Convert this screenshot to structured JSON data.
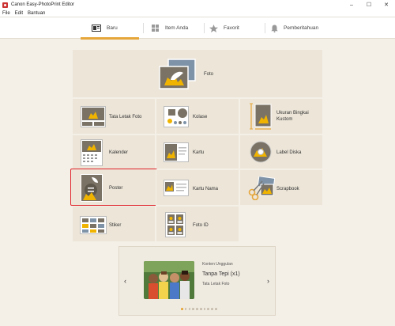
{
  "window": {
    "title": "Canon Easy-PhotoPrint Editor",
    "minimize": "–",
    "maximize": "☐",
    "close": "✕"
  },
  "menu": [
    "File",
    "Edit",
    "Bantuan"
  ],
  "tabs": [
    {
      "label": "Baru",
      "icon": "new-icon",
      "active": true
    },
    {
      "label": "Item Anda",
      "icon": "grid-icon",
      "active": false
    },
    {
      "label": "Favorit",
      "icon": "star-icon",
      "active": false
    },
    {
      "label": "Pemberitahuan",
      "icon": "bell-icon",
      "active": false
    }
  ],
  "items": {
    "foto": "Foto",
    "tata_letak_foto": "Tata Letak Foto",
    "kolase": "Kolase",
    "ukuran_bingkai": "Ukuran Bingkai\nKustom",
    "kalender": "Kalender",
    "kartu": "Kartu",
    "label_diska": "Label Diska",
    "poster": "Poster",
    "kartu_nama": "Kartu Nama",
    "scrapbook": "Scrapbook",
    "stiker": "Stiker",
    "foto_id": "Foto ID"
  },
  "carousel": {
    "small_label": "Konten Unggulan",
    "title": "Tanpa Tepi (x1)",
    "subtitle": "Tata Letak Foto",
    "prev": "‹",
    "next": "›",
    "dot_count": 10,
    "active_dot": 0
  },
  "colors": {
    "accent": "#e6a63a",
    "selection": "#e0232a",
    "tile": "#ece5d8",
    "background": "#f4f0e8"
  }
}
